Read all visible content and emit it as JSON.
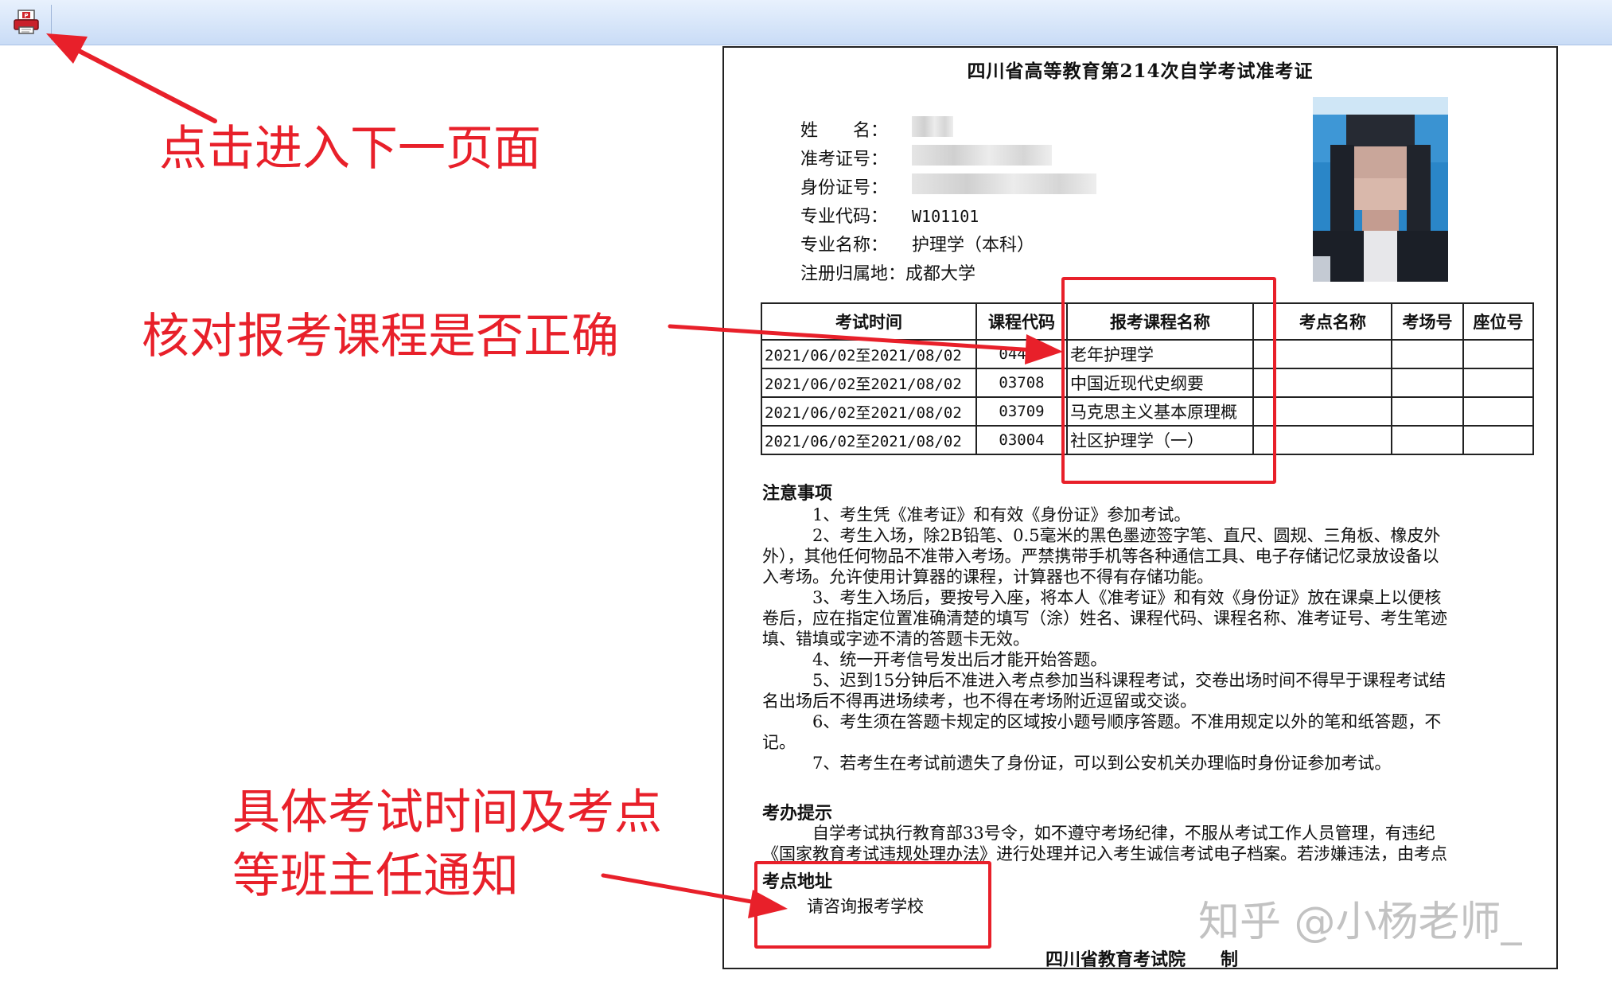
{
  "document": {
    "title": "四川省高等教育第214次自学考试准考证",
    "labels": {
      "name": "姓　　名：",
      "ticket": "准考证号：",
      "id": "身份证号：",
      "major_code": "专业代码：",
      "major_name": "专业名称：",
      "registry": "注册归属地："
    },
    "values": {
      "major_code": "W101101",
      "major_name": "护理学（本科）",
      "registry": "成都大学"
    },
    "table": {
      "headers": [
        "考试时间",
        "课程代码",
        "报考课程名称",
        "",
        "考点名称",
        "考场号",
        "座位号"
      ],
      "rows": [
        [
          "2021/06/02至2021/08/02",
          "04435",
          "老年护理学",
          "",
          "",
          "",
          ""
        ],
        [
          "2021/06/02至2021/08/02",
          "03708",
          "中国近现代史纲要",
          "",
          "",
          "",
          ""
        ],
        [
          "2021/06/02至2021/08/02",
          "03709",
          "马克思主义基本原理概",
          "",
          "",
          "",
          ""
        ],
        [
          "2021/06/02至2021/08/02",
          "03004",
          "社区护理学（一）",
          "",
          "",
          "",
          ""
        ]
      ]
    },
    "notes_heading": "注意事项",
    "notes": [
      "　　　1、考生凭《准考证》和有效《身份证》参加考试。",
      "　　　2、考生入场，除2B铅笔、0.5毫米的黑色墨迹签字笔、直尺、圆规、三角板、橡皮外",
      "外），其他任何物品不准带入考场。严禁携带手机等各种通信工具、电子存储记忆录放设备以",
      "入考场。允许使用计算器的课程，计算器也不得有存储功能。",
      "　　　3、考生入场后，要按号入座，将本人《准考证》和有效《身份证》放在课桌上以便核",
      "卷后，应在指定位置准确清楚的填写（涂）姓名、课程代码、课程名称、准考证号、考生笔迹",
      "填、错填或字迹不清的答题卡无效。",
      "　　　4、统一开考信号发出后才能开始答题。",
      "　　　5、迟到15分钟后不准进入考点参加当科课程考试，交卷出场时间不得早于课程考试结",
      "名出场后不得再进场续考，也不得在考场附近逗留或交谈。",
      "　　　6、考生须在答题卡规定的区域按小题号顺序答题。不准用规定以外的笔和纸答题，不",
      "记。",
      "　　　7、若考生在考试前遗失了身份证，可以到公安机关办理临时身份证参加考试。"
    ],
    "tips_heading": "考办提示",
    "tips": [
      "　　　自学考试执行教育部33号令，如不遵守考场纪律，不服从考试工作人员管理，有违纪",
      "《国家教育考试违规处理办法》进行处理并记入考生诚信考试电子档案。若涉嫌违法，由考点"
    ],
    "address_heading": "考点地址",
    "address_value": "请咨询报考学校",
    "footer": "四川省教育考试院　　制"
  },
  "annotations": {
    "next_page": "点击进入下一页面",
    "check_courses": "核对报考课程是否正确",
    "exam_time_line1": "具体考试时间及考点",
    "exam_time_line2": "等班主任通知"
  },
  "watermark": "知乎 @小杨老师_",
  "icons": {
    "print": "printer-icon"
  },
  "colors": {
    "annotation": "#e8202a",
    "toolbar": "#c9dcf6"
  }
}
